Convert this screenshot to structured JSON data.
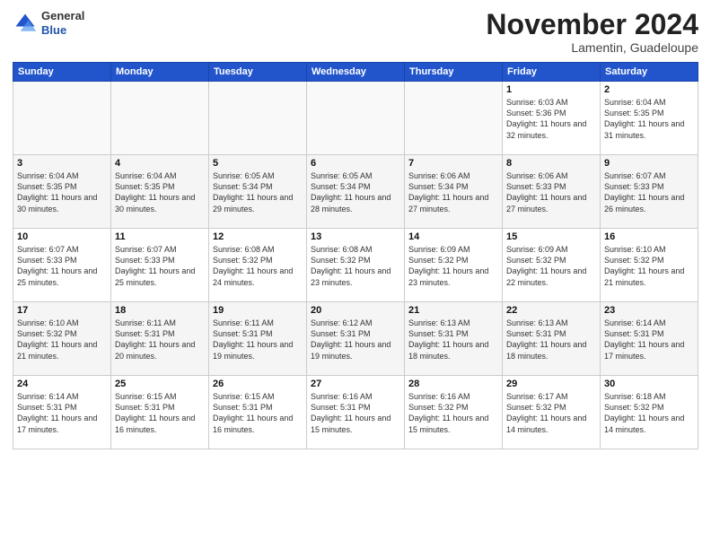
{
  "header": {
    "logo_line1": "General",
    "logo_line2": "Blue",
    "month": "November 2024",
    "location": "Lamentin, Guadeloupe"
  },
  "weekdays": [
    "Sunday",
    "Monday",
    "Tuesday",
    "Wednesday",
    "Thursday",
    "Friday",
    "Saturday"
  ],
  "weeks": [
    [
      {
        "day": "",
        "info": ""
      },
      {
        "day": "",
        "info": ""
      },
      {
        "day": "",
        "info": ""
      },
      {
        "day": "",
        "info": ""
      },
      {
        "day": "",
        "info": ""
      },
      {
        "day": "1",
        "info": "Sunrise: 6:03 AM\nSunset: 5:36 PM\nDaylight: 11 hours\nand 32 minutes."
      },
      {
        "day": "2",
        "info": "Sunrise: 6:04 AM\nSunset: 5:35 PM\nDaylight: 11 hours\nand 31 minutes."
      }
    ],
    [
      {
        "day": "3",
        "info": "Sunrise: 6:04 AM\nSunset: 5:35 PM\nDaylight: 11 hours\nand 30 minutes."
      },
      {
        "day": "4",
        "info": "Sunrise: 6:04 AM\nSunset: 5:35 PM\nDaylight: 11 hours\nand 30 minutes."
      },
      {
        "day": "5",
        "info": "Sunrise: 6:05 AM\nSunset: 5:34 PM\nDaylight: 11 hours\nand 29 minutes."
      },
      {
        "day": "6",
        "info": "Sunrise: 6:05 AM\nSunset: 5:34 PM\nDaylight: 11 hours\nand 28 minutes."
      },
      {
        "day": "7",
        "info": "Sunrise: 6:06 AM\nSunset: 5:34 PM\nDaylight: 11 hours\nand 27 minutes."
      },
      {
        "day": "8",
        "info": "Sunrise: 6:06 AM\nSunset: 5:33 PM\nDaylight: 11 hours\nand 27 minutes."
      },
      {
        "day": "9",
        "info": "Sunrise: 6:07 AM\nSunset: 5:33 PM\nDaylight: 11 hours\nand 26 minutes."
      }
    ],
    [
      {
        "day": "10",
        "info": "Sunrise: 6:07 AM\nSunset: 5:33 PM\nDaylight: 11 hours\nand 25 minutes."
      },
      {
        "day": "11",
        "info": "Sunrise: 6:07 AM\nSunset: 5:33 PM\nDaylight: 11 hours\nand 25 minutes."
      },
      {
        "day": "12",
        "info": "Sunrise: 6:08 AM\nSunset: 5:32 PM\nDaylight: 11 hours\nand 24 minutes."
      },
      {
        "day": "13",
        "info": "Sunrise: 6:08 AM\nSunset: 5:32 PM\nDaylight: 11 hours\nand 23 minutes."
      },
      {
        "day": "14",
        "info": "Sunrise: 6:09 AM\nSunset: 5:32 PM\nDaylight: 11 hours\nand 23 minutes."
      },
      {
        "day": "15",
        "info": "Sunrise: 6:09 AM\nSunset: 5:32 PM\nDaylight: 11 hours\nand 22 minutes."
      },
      {
        "day": "16",
        "info": "Sunrise: 6:10 AM\nSunset: 5:32 PM\nDaylight: 11 hours\nand 21 minutes."
      }
    ],
    [
      {
        "day": "17",
        "info": "Sunrise: 6:10 AM\nSunset: 5:32 PM\nDaylight: 11 hours\nand 21 minutes."
      },
      {
        "day": "18",
        "info": "Sunrise: 6:11 AM\nSunset: 5:31 PM\nDaylight: 11 hours\nand 20 minutes."
      },
      {
        "day": "19",
        "info": "Sunrise: 6:11 AM\nSunset: 5:31 PM\nDaylight: 11 hours\nand 19 minutes."
      },
      {
        "day": "20",
        "info": "Sunrise: 6:12 AM\nSunset: 5:31 PM\nDaylight: 11 hours\nand 19 minutes."
      },
      {
        "day": "21",
        "info": "Sunrise: 6:13 AM\nSunset: 5:31 PM\nDaylight: 11 hours\nand 18 minutes."
      },
      {
        "day": "22",
        "info": "Sunrise: 6:13 AM\nSunset: 5:31 PM\nDaylight: 11 hours\nand 18 minutes."
      },
      {
        "day": "23",
        "info": "Sunrise: 6:14 AM\nSunset: 5:31 PM\nDaylight: 11 hours\nand 17 minutes."
      }
    ],
    [
      {
        "day": "24",
        "info": "Sunrise: 6:14 AM\nSunset: 5:31 PM\nDaylight: 11 hours\nand 17 minutes."
      },
      {
        "day": "25",
        "info": "Sunrise: 6:15 AM\nSunset: 5:31 PM\nDaylight: 11 hours\nand 16 minutes."
      },
      {
        "day": "26",
        "info": "Sunrise: 6:15 AM\nSunset: 5:31 PM\nDaylight: 11 hours\nand 16 minutes."
      },
      {
        "day": "27",
        "info": "Sunrise: 6:16 AM\nSunset: 5:31 PM\nDaylight: 11 hours\nand 15 minutes."
      },
      {
        "day": "28",
        "info": "Sunrise: 6:16 AM\nSunset: 5:32 PM\nDaylight: 11 hours\nand 15 minutes."
      },
      {
        "day": "29",
        "info": "Sunrise: 6:17 AM\nSunset: 5:32 PM\nDaylight: 11 hours\nand 14 minutes."
      },
      {
        "day": "30",
        "info": "Sunrise: 6:18 AM\nSunset: 5:32 PM\nDaylight: 11 hours\nand 14 minutes."
      }
    ]
  ]
}
